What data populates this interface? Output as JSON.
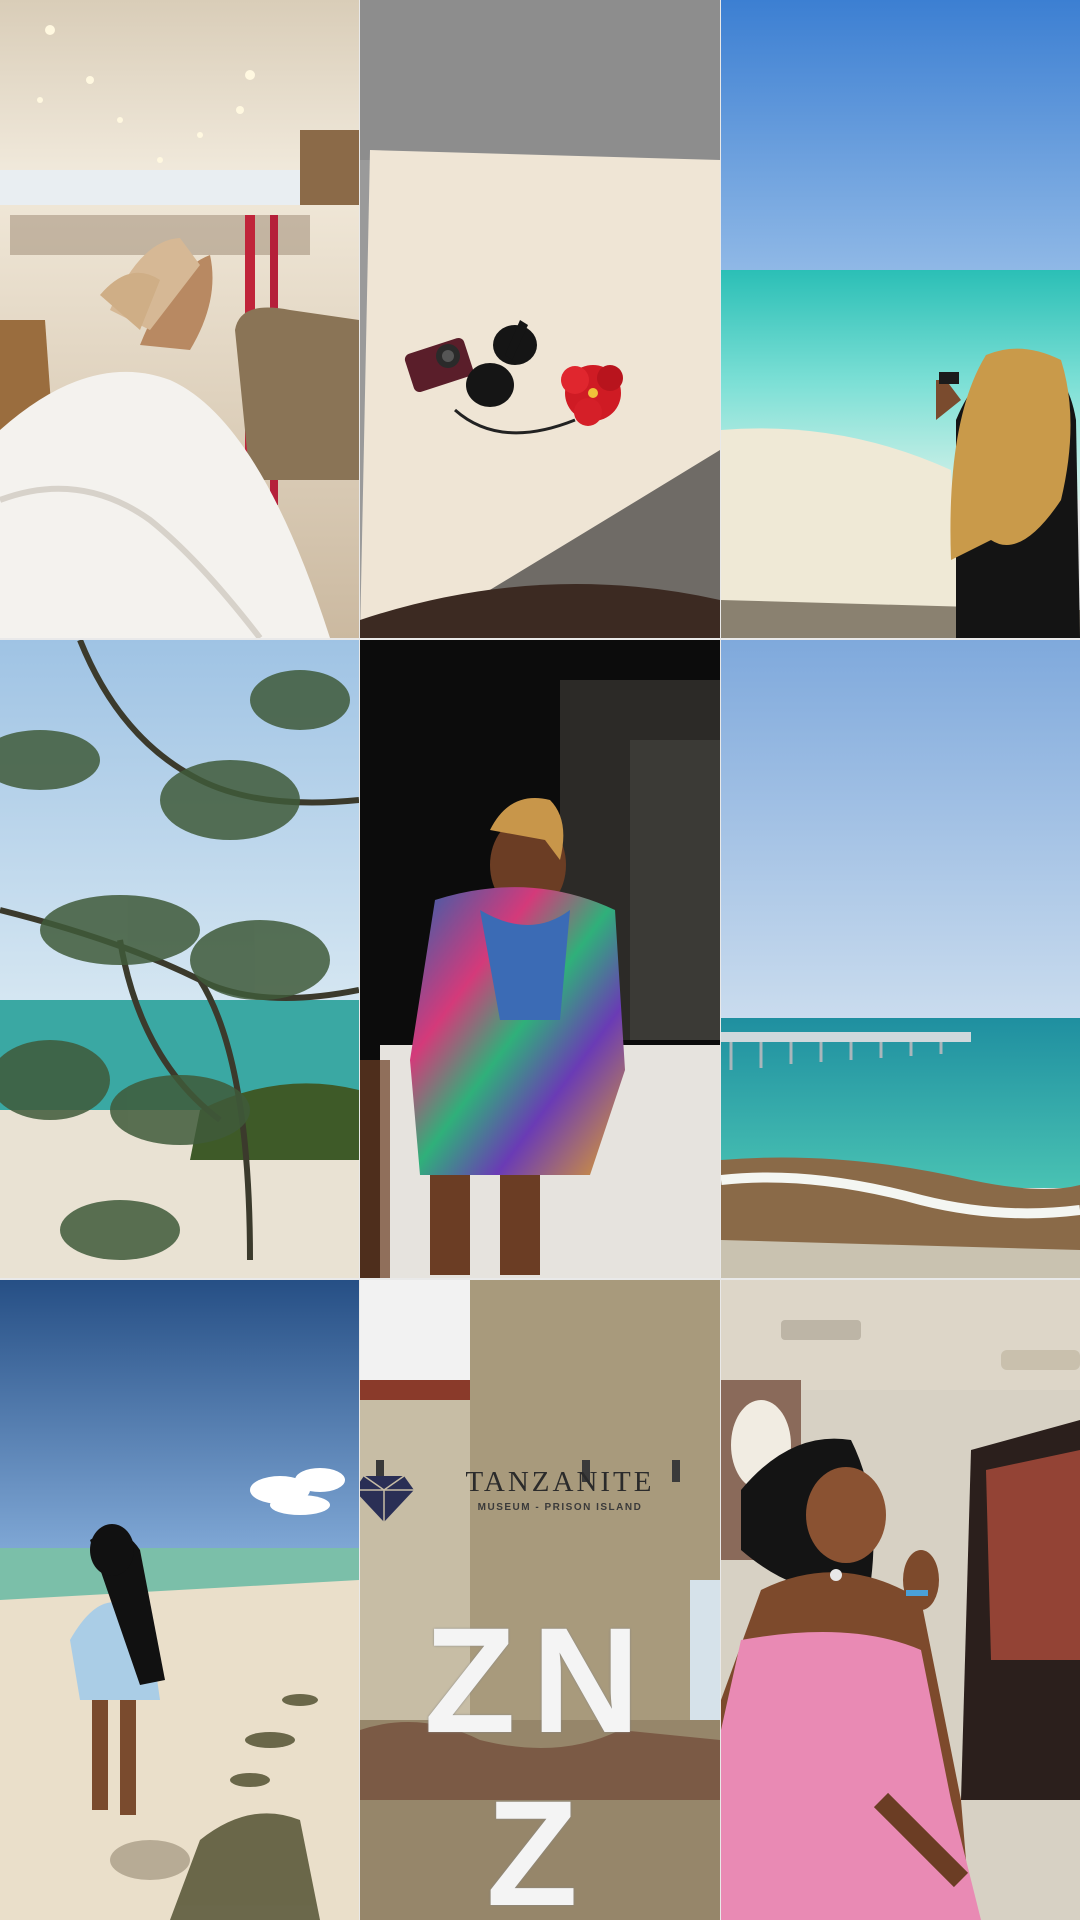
{
  "collage": {
    "tiles": [
      {
        "id": "airport-lounge",
        "row": 1,
        "col": 1
      },
      {
        "id": "camera-sunglasses-flower",
        "row": 1,
        "col": 2
      },
      {
        "id": "beach-photographer",
        "row": 1,
        "col": 3
      },
      {
        "id": "pine-branch-beach",
        "row": 2,
        "col": 1
      },
      {
        "id": "night-portrait-denim",
        "row": 2,
        "col": 2
      },
      {
        "id": "sea-pier",
        "row": 2,
        "col": 3
      },
      {
        "id": "woman-on-beach",
        "row": 3,
        "col": 1
      },
      {
        "id": "tanzanite-museum-wall",
        "row": 3,
        "col": 2
      },
      {
        "id": "car-portrait-pink-dress",
        "row": 3,
        "col": 3
      }
    ]
  },
  "museum_sign": {
    "title": "TANZANITE",
    "subtitle": "MUSEUM - PRISON ISLAND",
    "letters": "ZN Z"
  },
  "colors": {
    "sea": "#3ec8c0",
    "sky": "#5a8fd6",
    "sand": "#efe6d4",
    "dress_pink": "#e98ab4"
  }
}
